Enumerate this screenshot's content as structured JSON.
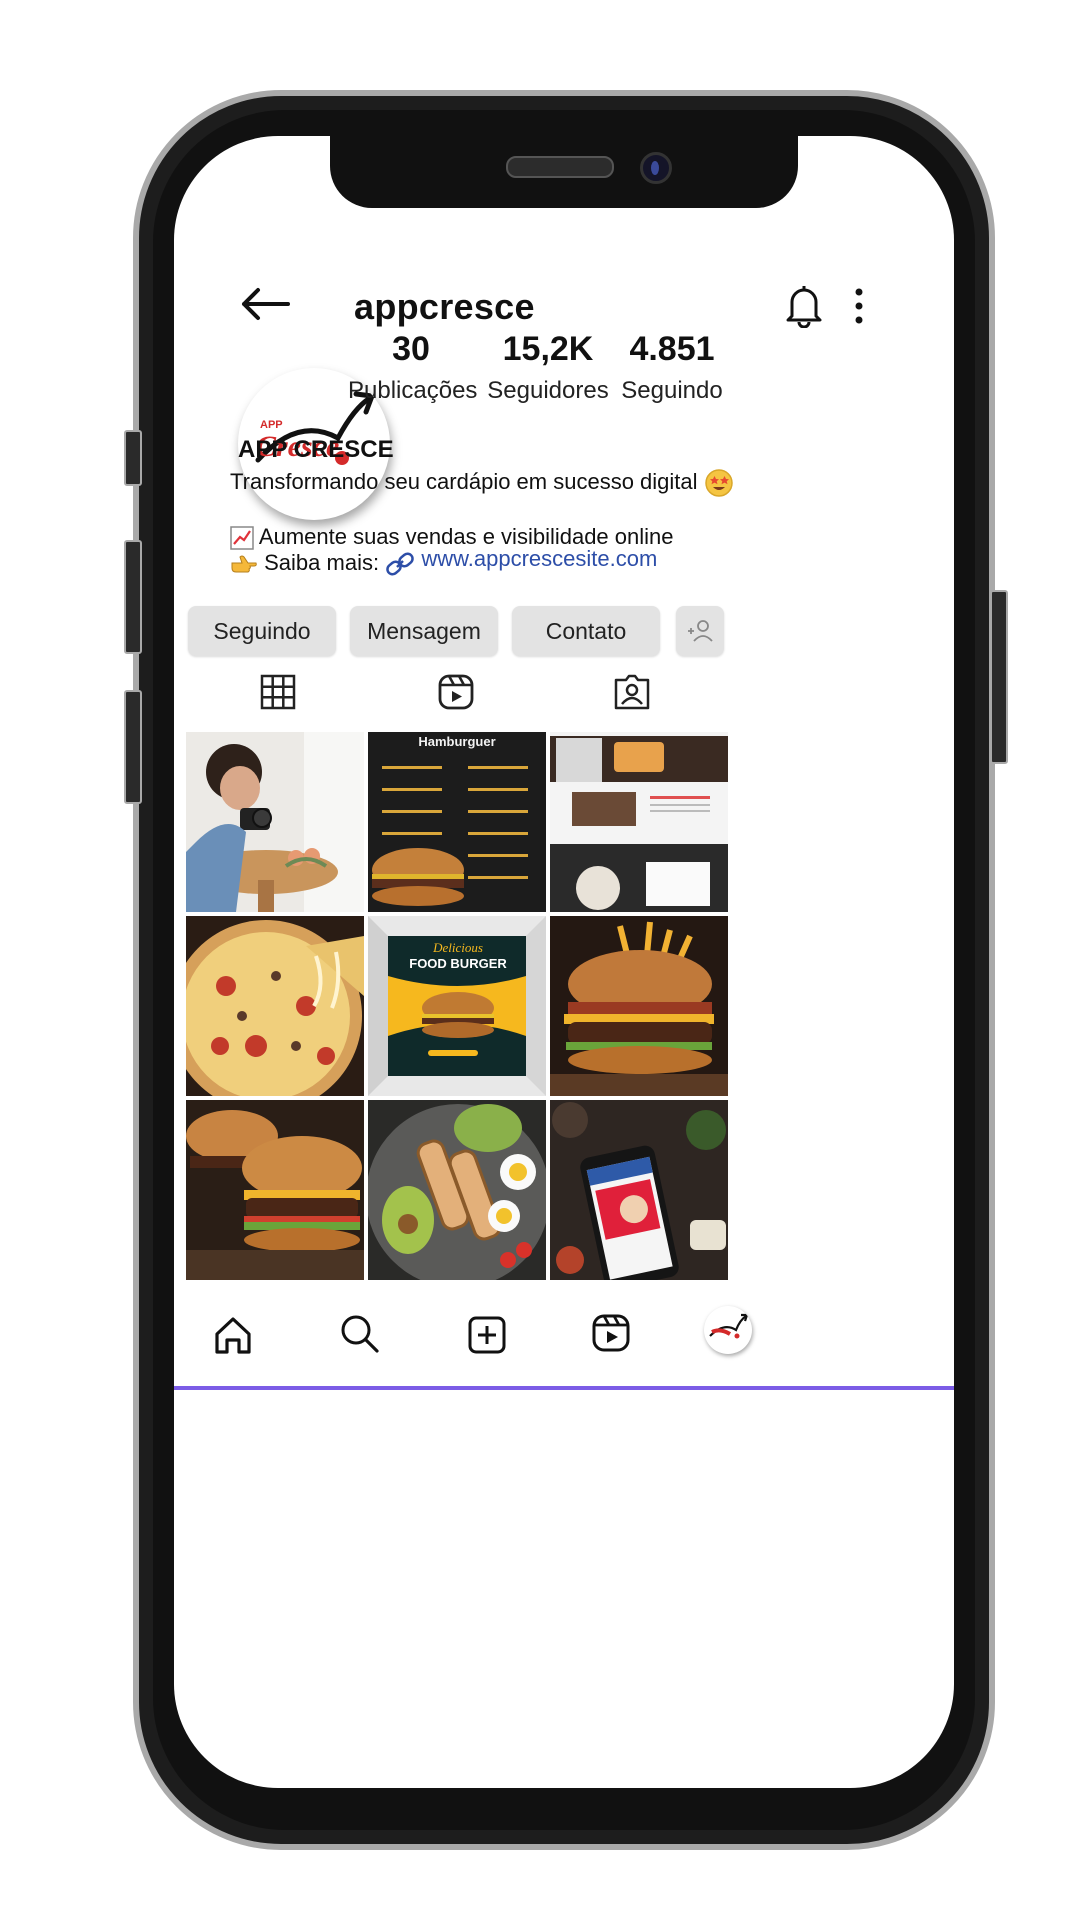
{
  "header": {
    "username": "appcresce"
  },
  "profile": {
    "display_name": "APP CRESCE",
    "logo_small_text": "APP",
    "logo_text": "Cresce",
    "bio_line1": "Transformando seu cardápio em sucesso digital",
    "bio_line2": "Aumente suas vendas e visibilidade online",
    "bio_line3_prefix": "Saiba mais:",
    "website": "www.appcrescesite.com"
  },
  "stats": {
    "posts_count": "30",
    "posts_label": "Publicações",
    "followers_count": "15,2K",
    "followers_label": "Seguidores",
    "following_count": "4.851",
    "following_label": "Seguindo"
  },
  "actions": {
    "following_label": "Seguindo",
    "message_label": "Mensagem",
    "contact_label": "Contato"
  },
  "posts": {
    "menu_title": "Hamburguer",
    "food_burger_script": "Delicious",
    "food_burger_title": "FOOD BURGER"
  },
  "colors": {
    "accent_link": "#2d4ea8",
    "button_bg": "#e3e3e3",
    "home_indicator": "#7b5ce6",
    "logo_red": "#d42a2a"
  }
}
